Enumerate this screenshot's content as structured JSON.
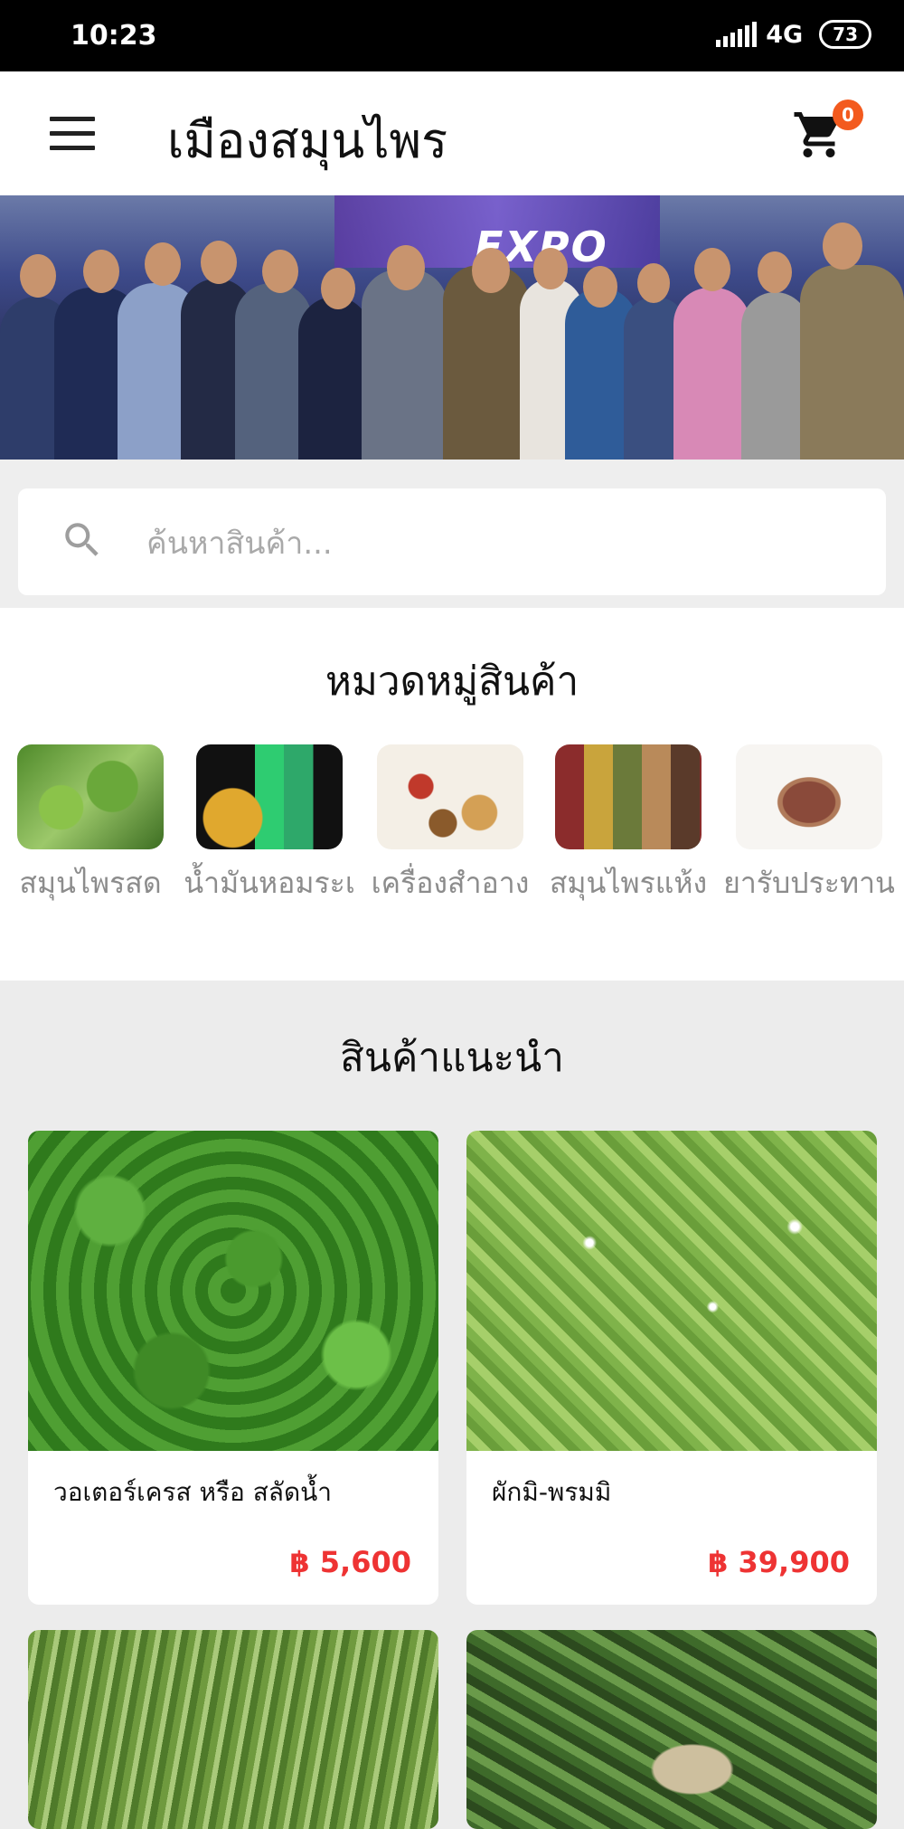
{
  "status_bar": {
    "time": "10:23",
    "network": "4G",
    "battery": "73"
  },
  "app_bar": {
    "title": "เมืองสมุนไพร",
    "cart_count": "0"
  },
  "banner": {
    "sign_text": "EXPO",
    "slide_count": 5,
    "active_slide": 1
  },
  "search": {
    "placeholder": "ค้นหาสินค้า..."
  },
  "categories": {
    "title": "หมวดหมู่สินค้า",
    "items": [
      {
        "label": "สมุนไพรสด"
      },
      {
        "label": "น้ำมันหอมระเ"
      },
      {
        "label": "เครื่องสำอาง"
      },
      {
        "label": "สมุนไพรแห้ง"
      },
      {
        "label": "ยารับประทาน"
      }
    ]
  },
  "featured": {
    "title": "สินค้าแนะนำ",
    "products": [
      {
        "name": "วอเตอร์เครส หรือ สลัดน้ำ",
        "price": "฿ 5,600"
      },
      {
        "name": "ผักมิ-พรมมิ",
        "price": "฿ 39,900"
      },
      {
        "name": "",
        "price": ""
      },
      {
        "name": "",
        "price": ""
      }
    ]
  },
  "colors": {
    "accent": "#f35a1e",
    "price": "#e33333",
    "dot_active": "#f5a623"
  }
}
